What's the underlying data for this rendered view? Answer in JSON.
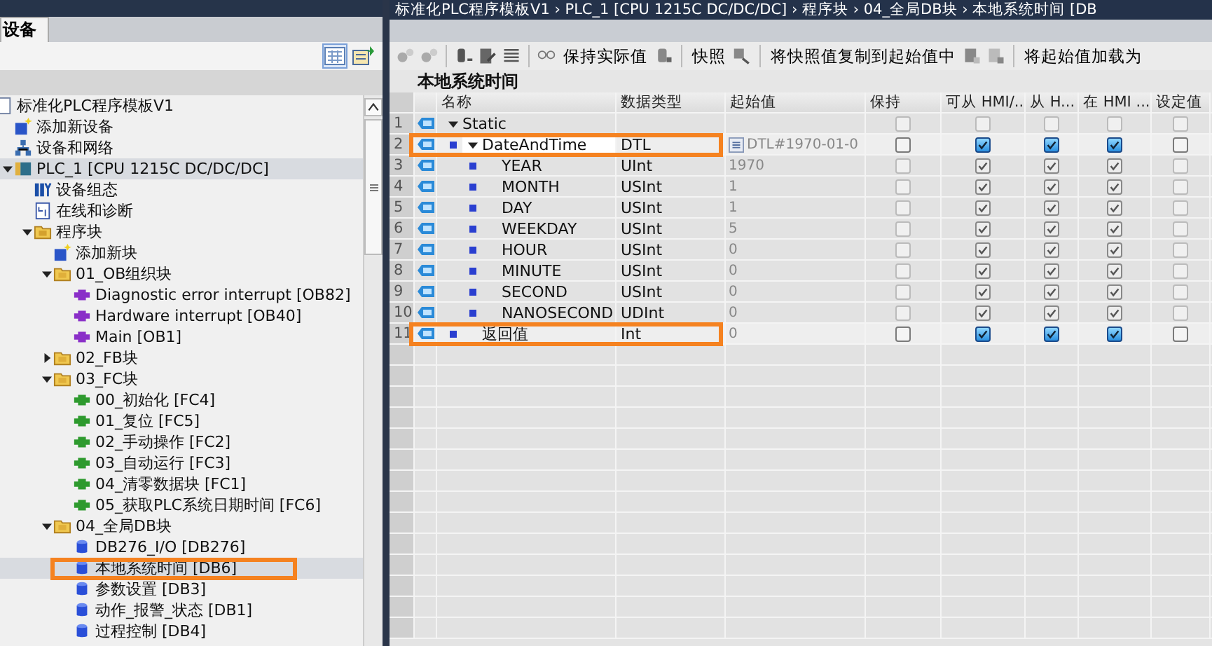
{
  "breadcrumb": "标准化PLC程序模板V1 › PLC_1 [CPU 1215C DC/DC/DC] › 程序块 › 04_全局DB块 › 本地系统时间 [DB",
  "project_tree": {
    "tab": {
      "label": "设备",
      "selected": true
    },
    "items": [
      {
        "label": "标准化PLC程序模板V1",
        "kind": "project",
        "selected": false,
        "children": [
          {
            "label": "添加新设备",
            "kind": "add",
            "selected": false
          },
          {
            "label": "设备和网络",
            "kind": "network",
            "selected": false
          },
          {
            "label": "PLC_1 [CPU 1215C DC/DC/DC]",
            "kind": "plc",
            "selected": true,
            "expanded": true,
            "children": [
              {
                "label": "设备组态",
                "kind": "config",
                "selected": false
              },
              {
                "label": "在线和诊断",
                "kind": "online",
                "selected": false
              },
              {
                "label": "程序块",
                "kind": "blocks",
                "selected": false,
                "expanded": true,
                "children": [
                  {
                    "label": "添加新块",
                    "kind": "add",
                    "selected": false
                  },
                  {
                    "label": "01_OB组织块",
                    "kind": "folder",
                    "selected": false,
                    "expanded": true,
                    "children": [
                      {
                        "label": "Diagnostic error interrupt [OB82]",
                        "kind": "ob",
                        "selected": false
                      },
                      {
                        "label": "Hardware interrupt [OB40]",
                        "kind": "ob",
                        "selected": false
                      },
                      {
                        "label": "Main [OB1]",
                        "kind": "ob",
                        "selected": false
                      }
                    ]
                  },
                  {
                    "label": "02_FB块",
                    "kind": "folder",
                    "selected": false,
                    "expanded": false
                  },
                  {
                    "label": "03_FC块",
                    "kind": "folder",
                    "selected": false,
                    "expanded": true,
                    "children": [
                      {
                        "label": "00_初始化 [FC4]",
                        "kind": "fc",
                        "selected": false
                      },
                      {
                        "label": "01_复位 [FC5]",
                        "kind": "fc",
                        "selected": false
                      },
                      {
                        "label": "02_手动操作 [FC2]",
                        "kind": "fc",
                        "selected": false
                      },
                      {
                        "label": "03_自动运行 [FC3]",
                        "kind": "fc",
                        "selected": false
                      },
                      {
                        "label": "04_清零数据块 [FC1]",
                        "kind": "fc",
                        "selected": false
                      },
                      {
                        "label": "05_获取PLC系统日期时间 [FC6]",
                        "kind": "fc",
                        "selected": false
                      }
                    ]
                  },
                  {
                    "label": "04_全局DB块",
                    "kind": "folder",
                    "selected": false,
                    "expanded": true,
                    "children": [
                      {
                        "label": "DB276_I/O [DB276]",
                        "kind": "db",
                        "selected": false
                      },
                      {
                        "label": "本地系统时间 [DB6]",
                        "kind": "db",
                        "selected": true,
                        "highlighted": true
                      },
                      {
                        "label": "参数设置 [DB3]",
                        "kind": "db",
                        "selected": false
                      },
                      {
                        "label": "动作_报警_状态 [DB1]",
                        "kind": "db",
                        "selected": false
                      },
                      {
                        "label": "过程控制 [DB4]",
                        "kind": "db",
                        "selected": false
                      }
                    ]
                  }
                ]
              }
            ]
          }
        ]
      }
    ]
  },
  "toolbar": [
    {
      "label": "保持实际值"
    },
    {
      "label": "快照"
    },
    {
      "label": "将快照值复制到起始值中"
    },
    {
      "label": "将起始值加载为"
    }
  ],
  "block_title": "本地系统时间",
  "table": {
    "columns": [
      "名称",
      "数据类型",
      "起始值",
      "保持",
      "可从 HMI/...",
      "从 H...",
      "在 HMI ...",
      "设定值"
    ],
    "rows": [
      {
        "number": "1",
        "name": "Static",
        "kind": "section",
        "expanded": true,
        "editing": false,
        "disabled": true,
        "checks": [
          false,
          false,
          false,
          false,
          false
        ],
        "children": [
          {
            "number": "2",
            "name": "DateAndTime",
            "kind": "struct",
            "type": "DTL",
            "start": "DTL#1970-01-0",
            "expanded": true,
            "editing": true,
            "highlighted": true,
            "disabled": false,
            "checks": [
              false,
              true,
              true,
              true,
              false
            ],
            "children": [
              {
                "number": "3",
                "name": "YEAR",
                "kind": "member",
                "type": "UInt",
                "start": "1970",
                "editing": false,
                "disabled": true,
                "checks": [
                  false,
                  true,
                  true,
                  true,
                  false
                ]
              },
              {
                "number": "4",
                "name": "MONTH",
                "kind": "member",
                "type": "USInt",
                "start": "1",
                "editing": false,
                "disabled": true,
                "checks": [
                  false,
                  true,
                  true,
                  true,
                  false
                ]
              },
              {
                "number": "5",
                "name": "DAY",
                "kind": "member",
                "type": "USInt",
                "start": "1",
                "editing": false,
                "disabled": true,
                "checks": [
                  false,
                  true,
                  true,
                  true,
                  false
                ]
              },
              {
                "number": "6",
                "name": "WEEKDAY",
                "kind": "member",
                "type": "USInt",
                "start": "5",
                "editing": false,
                "disabled": true,
                "checks": [
                  false,
                  true,
                  true,
                  true,
                  false
                ]
              },
              {
                "number": "7",
                "name": "HOUR",
                "kind": "member",
                "type": "USInt",
                "start": "0",
                "editing": false,
                "disabled": true,
                "checks": [
                  false,
                  true,
                  true,
                  true,
                  false
                ]
              },
              {
                "number": "8",
                "name": "MINUTE",
                "kind": "member",
                "type": "USInt",
                "start": "0",
                "editing": false,
                "disabled": true,
                "checks": [
                  false,
                  true,
                  true,
                  true,
                  false
                ]
              },
              {
                "number": "9",
                "name": "SECOND",
                "kind": "member",
                "type": "USInt",
                "start": "0",
                "editing": false,
                "disabled": true,
                "checks": [
                  false,
                  true,
                  true,
                  true,
                  false
                ]
              },
              {
                "number": "10",
                "name": "NANOSECOND",
                "kind": "member",
                "type": "UDInt",
                "start": "0",
                "editing": false,
                "disabled": true,
                "checks": [
                  false,
                  true,
                  true,
                  true,
                  false
                ]
              }
            ]
          },
          {
            "number": "11",
            "name": "返回值",
            "kind": "var",
            "type": "Int",
            "start": "0",
            "editing": false,
            "highlighted": true,
            "disabled": false,
            "checks": [
              false,
              true,
              true,
              true,
              false
            ]
          }
        ]
      }
    ]
  }
}
